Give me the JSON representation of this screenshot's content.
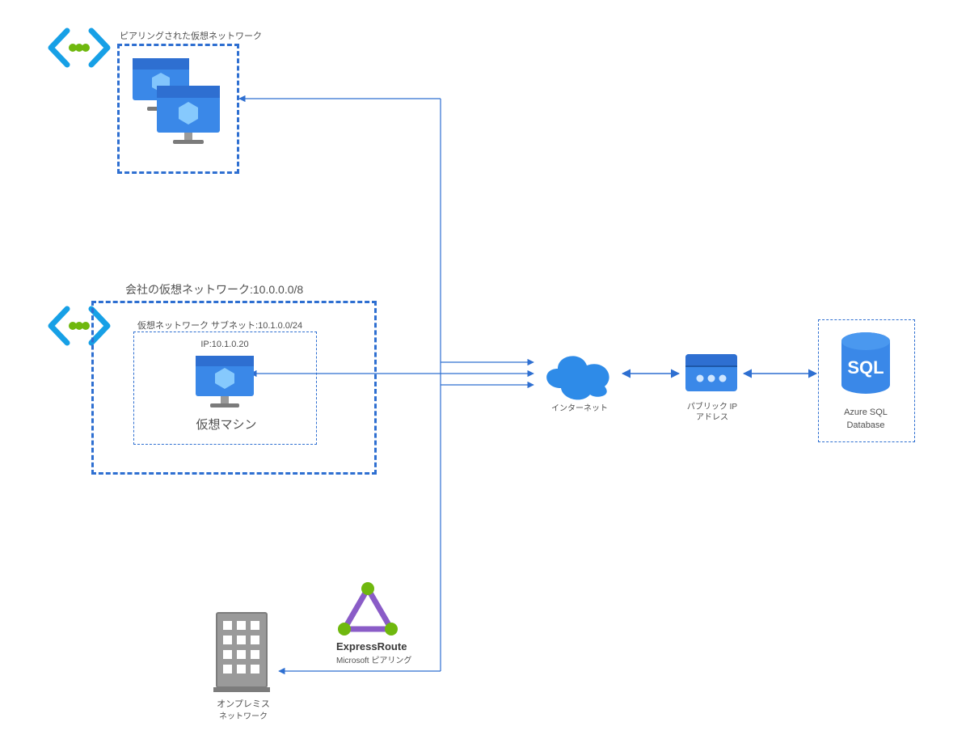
{
  "peered_vnet": {
    "title": "ピアリングされた仮想ネットワーク"
  },
  "company_vnet": {
    "title": "会社の仮想ネットワーク:10.0.0.0/8",
    "subnet": "仮想ネットワーク サブネット:10.1.0.0/24",
    "vm_ip": "IP:10.1.0.20",
    "vm_label": "仮想マシン"
  },
  "internet": {
    "label": "インターネット"
  },
  "public_ip": {
    "label1": "パブリック IP",
    "label2": "アドレス"
  },
  "sql": {
    "name": "SQL",
    "label1": "Azure SQL",
    "label2": "Database"
  },
  "expressroute": {
    "name": "ExpressRoute",
    "sub": "Microsoft ピアリング"
  },
  "onprem": {
    "label1": "オンプレミス",
    "label2": "ネットワーク"
  },
  "colors": {
    "azure": "#2e6fd1",
    "azure_light": "#3a88e8",
    "green": "#6fb80e",
    "grey": "#888888",
    "dark": "#3a3a3a"
  }
}
